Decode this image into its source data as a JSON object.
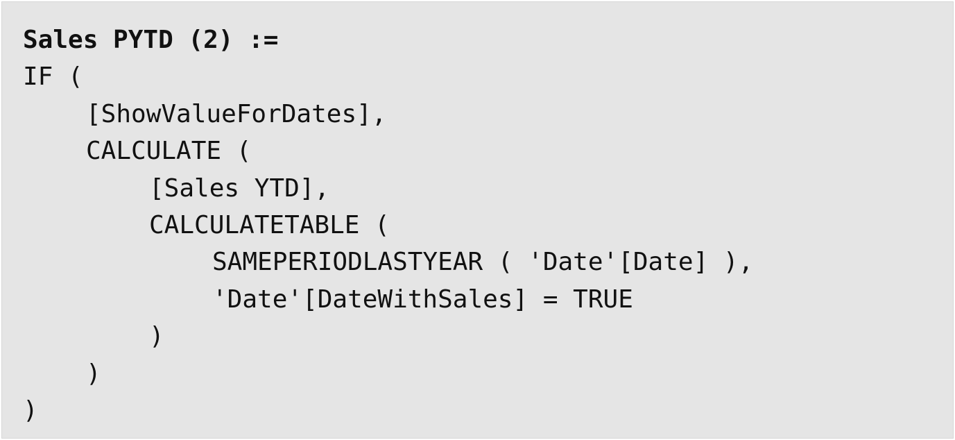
{
  "code": {
    "lines": [
      "Sales PYTD (2) :=",
      "IF (",
      "[ShowValueForDates],",
      "CALCULATE (",
      "[Sales YTD],",
      "CALCULATETABLE (",
      "SAMEPERIODLASTYEAR ( 'Date'[Date] ),",
      "'Date'[DateWithSales] = TRUE",
      ")",
      ")",
      ")"
    ]
  }
}
